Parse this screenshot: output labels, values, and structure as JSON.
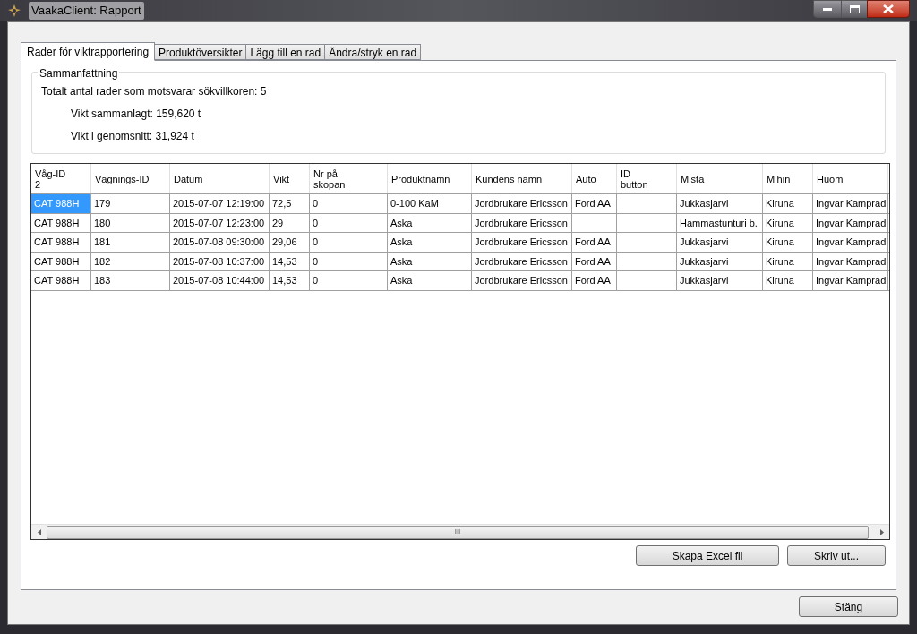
{
  "window": {
    "title": "VaakaClient: Rapport"
  },
  "tabs": [
    {
      "label": "Rader för viktrapportering",
      "selected": true
    },
    {
      "label": "Produktöversikter",
      "selected": false
    },
    {
      "label": "Lägg till en rad",
      "selected": false
    },
    {
      "label": "Ändra/stryk en rad",
      "selected": false
    }
  ],
  "summary": {
    "title": "Sammanfattning",
    "total": "Totalt antal rader som motsvarar sökvillkoren: 5",
    "sum": "Vikt sammanlagt: 159,620 t",
    "average": "Vikt i genomsnitt: 31,924 t"
  },
  "table": {
    "columns": [
      "Våg-ID\n2",
      "Vägnings-ID",
      "Datum",
      "Vikt",
      "Nr på\nskopan",
      "Produktnamn",
      "Kundens namn",
      "Auto",
      "ID\nbutton",
      "Mistä",
      "Mihin",
      "Huom"
    ],
    "rows": [
      {
        "cells": [
          {
            "text": "CAT 988H",
            "selected": true
          },
          {
            "text": "179",
            "selected": false
          },
          {
            "text": "2015-07-07 12:19:00",
            "selected": false
          },
          {
            "text": "72,5",
            "selected": false
          },
          {
            "text": "0",
            "selected": false
          },
          {
            "text": "0-100 KaM",
            "selected": false
          },
          {
            "text": "Jordbrukare Ericsson",
            "selected": false
          },
          {
            "text": "Ford AA",
            "selected": false
          },
          {
            "selected": false
          },
          {
            "text": "Jukkasjarvi",
            "selected": false
          },
          {
            "text": "Kiruna",
            "selected": false
          },
          {
            "text": "Ingvar Kamprad",
            "selected": false
          }
        ]
      },
      {
        "cells": [
          {
            "text": "CAT 988H",
            "selected": false
          },
          {
            "text": "180",
            "selected": false
          },
          {
            "text": "2015-07-07 12:23:00",
            "selected": false
          },
          {
            "text": "29",
            "selected": false
          },
          {
            "text": "0",
            "selected": false
          },
          {
            "text": "Aska",
            "selected": false
          },
          {
            "text": "Jordbrukare Ericsson",
            "selected": false
          },
          {
            "selected": false
          },
          {
            "selected": false
          },
          {
            "text": "Hammastunturi b.",
            "selected": false
          },
          {
            "text": "Kiruna",
            "selected": false
          },
          {
            "text": "Ingvar Kamprad",
            "selected": false
          }
        ]
      },
      {
        "cells": [
          {
            "text": "CAT 988H",
            "selected": false
          },
          {
            "text": "181",
            "selected": false
          },
          {
            "text": "2015-07-08 09:30:00",
            "selected": false
          },
          {
            "text": "29,06",
            "selected": false
          },
          {
            "text": "0",
            "selected": false
          },
          {
            "text": "Aska",
            "selected": false
          },
          {
            "text": "Jordbrukare Ericsson",
            "selected": false
          },
          {
            "text": "Ford AA",
            "selected": false
          },
          {
            "selected": false
          },
          {
            "text": "Jukkasjarvi",
            "selected": false
          },
          {
            "text": "Kiruna",
            "selected": false
          },
          {
            "text": "Ingvar Kamprad",
            "selected": false
          }
        ]
      },
      {
        "cells": [
          {
            "text": "CAT 988H",
            "selected": false
          },
          {
            "text": "182",
            "selected": false
          },
          {
            "text": "2015-07-08 10:37:00",
            "selected": false
          },
          {
            "text": "14,53",
            "selected": false
          },
          {
            "text": "0",
            "selected": false
          },
          {
            "text": "Aska",
            "selected": false
          },
          {
            "text": "Jordbrukare Ericsson",
            "selected": false
          },
          {
            "text": "Ford AA",
            "selected": false
          },
          {
            "selected": false
          },
          {
            "text": "Jukkasjarvi",
            "selected": false
          },
          {
            "text": "Kiruna",
            "selected": false
          },
          {
            "text": "Ingvar Kamprad",
            "selected": false
          }
        ]
      },
      {
        "cells": [
          {
            "text": "CAT 988H",
            "selected": false
          },
          {
            "text": "183",
            "selected": false
          },
          {
            "text": "2015-07-08 10:44:00",
            "selected": false
          },
          {
            "text": "14,53",
            "selected": false
          },
          {
            "text": "0",
            "selected": false
          },
          {
            "text": "Aska",
            "selected": false
          },
          {
            "text": "Jordbrukare Ericsson",
            "selected": false
          },
          {
            "text": "Ford AA",
            "selected": false
          },
          {
            "selected": false
          },
          {
            "text": "Jukkasjarvi",
            "selected": false
          },
          {
            "text": "Kiruna",
            "selected": false
          },
          {
            "text": "Ingvar Kamprad",
            "selected": false
          }
        ]
      }
    ],
    "scroll_thumb": "III"
  },
  "actions": [
    "Skapa Excel fil",
    "Skriv ut..."
  ],
  "close_button": "Stäng"
}
